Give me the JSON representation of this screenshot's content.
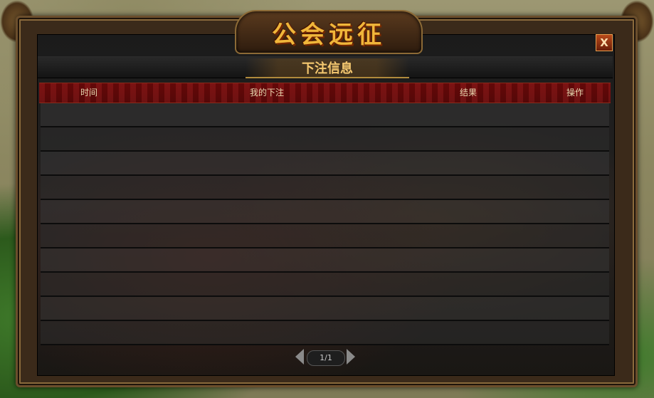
{
  "window": {
    "title": "公会远征",
    "close_label": "X"
  },
  "section": {
    "title": "下注信息"
  },
  "table": {
    "columns": [
      "时间",
      "我的下注",
      "结果",
      "操作"
    ],
    "rows": [
      [],
      [],
      [],
      [],
      [],
      [],
      [],
      [],
      [],
      []
    ]
  },
  "pager": {
    "page_text": "1/1"
  },
  "colors": {
    "title": "#f0b63a",
    "header_bg": "#5a0808",
    "frame": "#6b4e2c"
  }
}
